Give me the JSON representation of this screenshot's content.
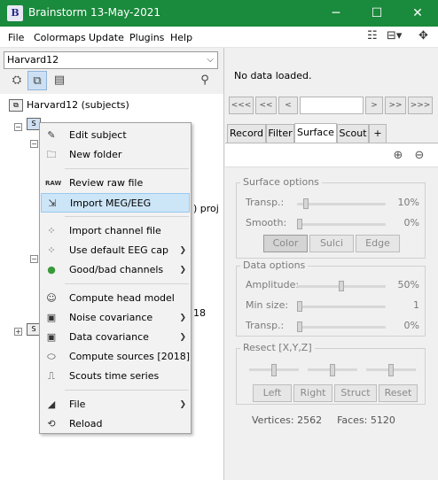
{
  "window": {
    "title": "Brainstorm 13-May-2021",
    "minimize": "─",
    "maximize": "☐",
    "close": "✕"
  },
  "menubar": {
    "items": [
      "File",
      "Colormaps",
      "Update",
      "Plugins",
      "Help"
    ]
  },
  "left": {
    "protocol": "Harvard12",
    "tree": {
      "root_label": "Harvard12 (subjects)",
      "partial_text_1": ") proj",
      "partial_text_2": "18"
    }
  },
  "context_menu": {
    "items": [
      {
        "label": "Edit subject",
        "icon": "edit-icon",
        "submenu": false
      },
      {
        "label": "New folder",
        "icon": "folder-icon",
        "submenu": false
      },
      {
        "label": "Review raw file",
        "icon": "raw-icon",
        "submenu": false
      },
      {
        "label": "Import MEG/EEG",
        "icon": "import-icon",
        "submenu": false,
        "highlighted": true
      },
      {
        "label": "Import channel file",
        "icon": "channel-icon",
        "submenu": false
      },
      {
        "label": "Use default EEG cap",
        "icon": "eeg-cap-icon",
        "submenu": true
      },
      {
        "label": "Good/bad channels",
        "icon": "good-bad-icon",
        "submenu": true
      },
      {
        "label": "Compute head model",
        "icon": "head-model-icon",
        "submenu": false
      },
      {
        "label": "Noise covariance",
        "icon": "noise-cov-icon",
        "submenu": true
      },
      {
        "label": "Data covariance",
        "icon": "data-cov-icon",
        "submenu": true
      },
      {
        "label": "Compute sources [2018]",
        "icon": "sources-icon",
        "submenu": false
      },
      {
        "label": "Scouts time series",
        "icon": "scouts-icon",
        "submenu": false
      },
      {
        "label": "File",
        "icon": "file-icon",
        "submenu": true
      },
      {
        "label": "Reload",
        "icon": "reload-icon",
        "submenu": false
      }
    ]
  },
  "right": {
    "status": "No data loaded.",
    "nav": [
      "<<<",
      "<<",
      "<",
      ">",
      ">>",
      ">>>"
    ],
    "tabs": [
      "Record",
      "Filter",
      "Surface",
      "Scout",
      "+"
    ],
    "active_tab": "Surface",
    "surface_options": {
      "title": "Surface options",
      "transp_label": "Transp.:",
      "transp_value": "10%",
      "transp_level": 0.1,
      "smooth_label": "Smooth:",
      "smooth_value": "0%",
      "smooth_level": 0.0,
      "buttons": [
        "Color",
        "Sulci",
        "Edge"
      ]
    },
    "data_options": {
      "title": "Data options",
      "amplitude_label": "Amplitude:",
      "amplitude_value": "50%",
      "amplitude_level": 0.5,
      "minsize_label": "Min size:",
      "minsize_value": "1",
      "transp_label": "Transp.:",
      "transp_value": "0%"
    },
    "resect": {
      "title": "Resect [X,Y,Z]",
      "buttons": [
        "Left",
        "Right",
        "Struct",
        "Reset"
      ]
    },
    "footer": {
      "vertices": "Vertices: 2562",
      "faces": "Faces: 5120"
    }
  }
}
